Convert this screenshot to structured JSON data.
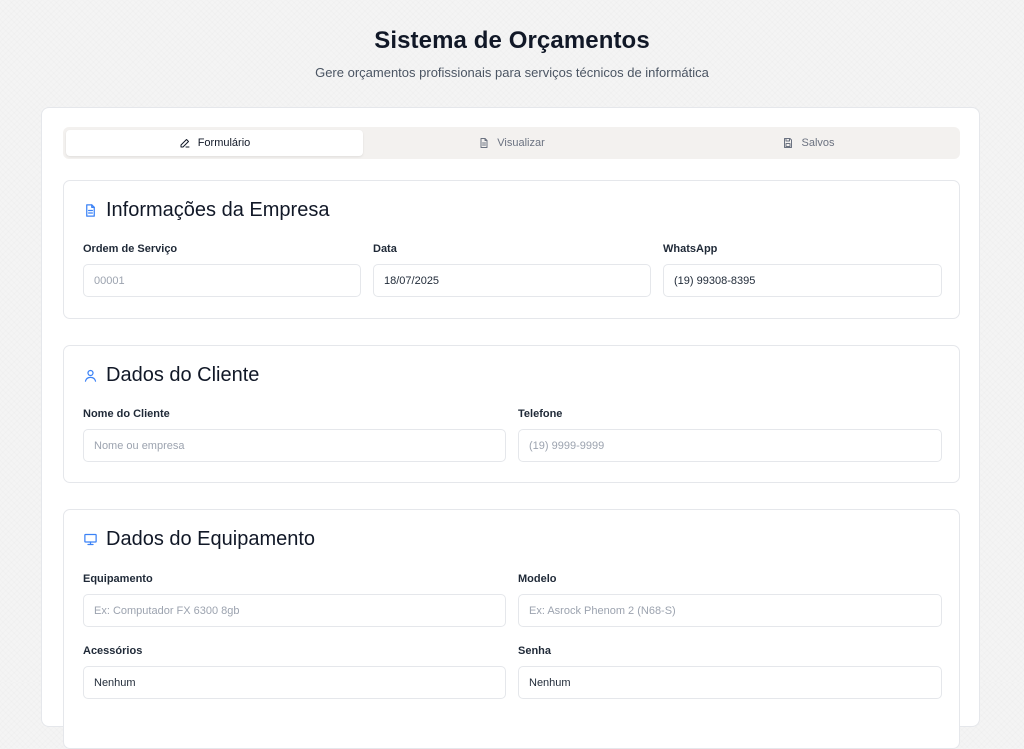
{
  "header": {
    "title": "Sistema de Orçamentos",
    "subtitle": "Gere orçamentos profissionais para serviços técnicos de informática"
  },
  "tabs": [
    {
      "label": "Formulário",
      "icon": "pencil-icon",
      "active": true
    },
    {
      "label": "Visualizar",
      "icon": "document-icon",
      "active": false
    },
    {
      "label": "Salvos",
      "icon": "save-icon",
      "active": false
    }
  ],
  "company": {
    "title": "Informações da Empresa",
    "icon": "document-icon",
    "order_label": "Ordem de Serviço",
    "order_placeholder": "00001",
    "date_label": "Data",
    "date_value": "18/07/2025",
    "whatsapp_label": "WhatsApp",
    "whatsapp_value": "(19) 99308-8395"
  },
  "client": {
    "title": "Dados do Cliente",
    "icon": "user-icon",
    "name_label": "Nome do Cliente",
    "name_placeholder": "Nome ou empresa",
    "phone_label": "Telefone",
    "phone_placeholder": "(19) 9999-9999"
  },
  "equipment": {
    "title": "Dados do Equipamento",
    "icon": "monitor-icon",
    "equipment_label": "Equipamento",
    "equipment_placeholder": "Ex: Computador FX 6300 8gb",
    "model_label": "Modelo",
    "model_placeholder": "Ex: Asrock Phenom 2 (N68-S)",
    "accessories_label": "Acessórios",
    "accessories_value": "Nenhum",
    "password_label": "Senha",
    "password_value": "Nenhum"
  },
  "colors": {
    "accent": "#3b82f6"
  }
}
